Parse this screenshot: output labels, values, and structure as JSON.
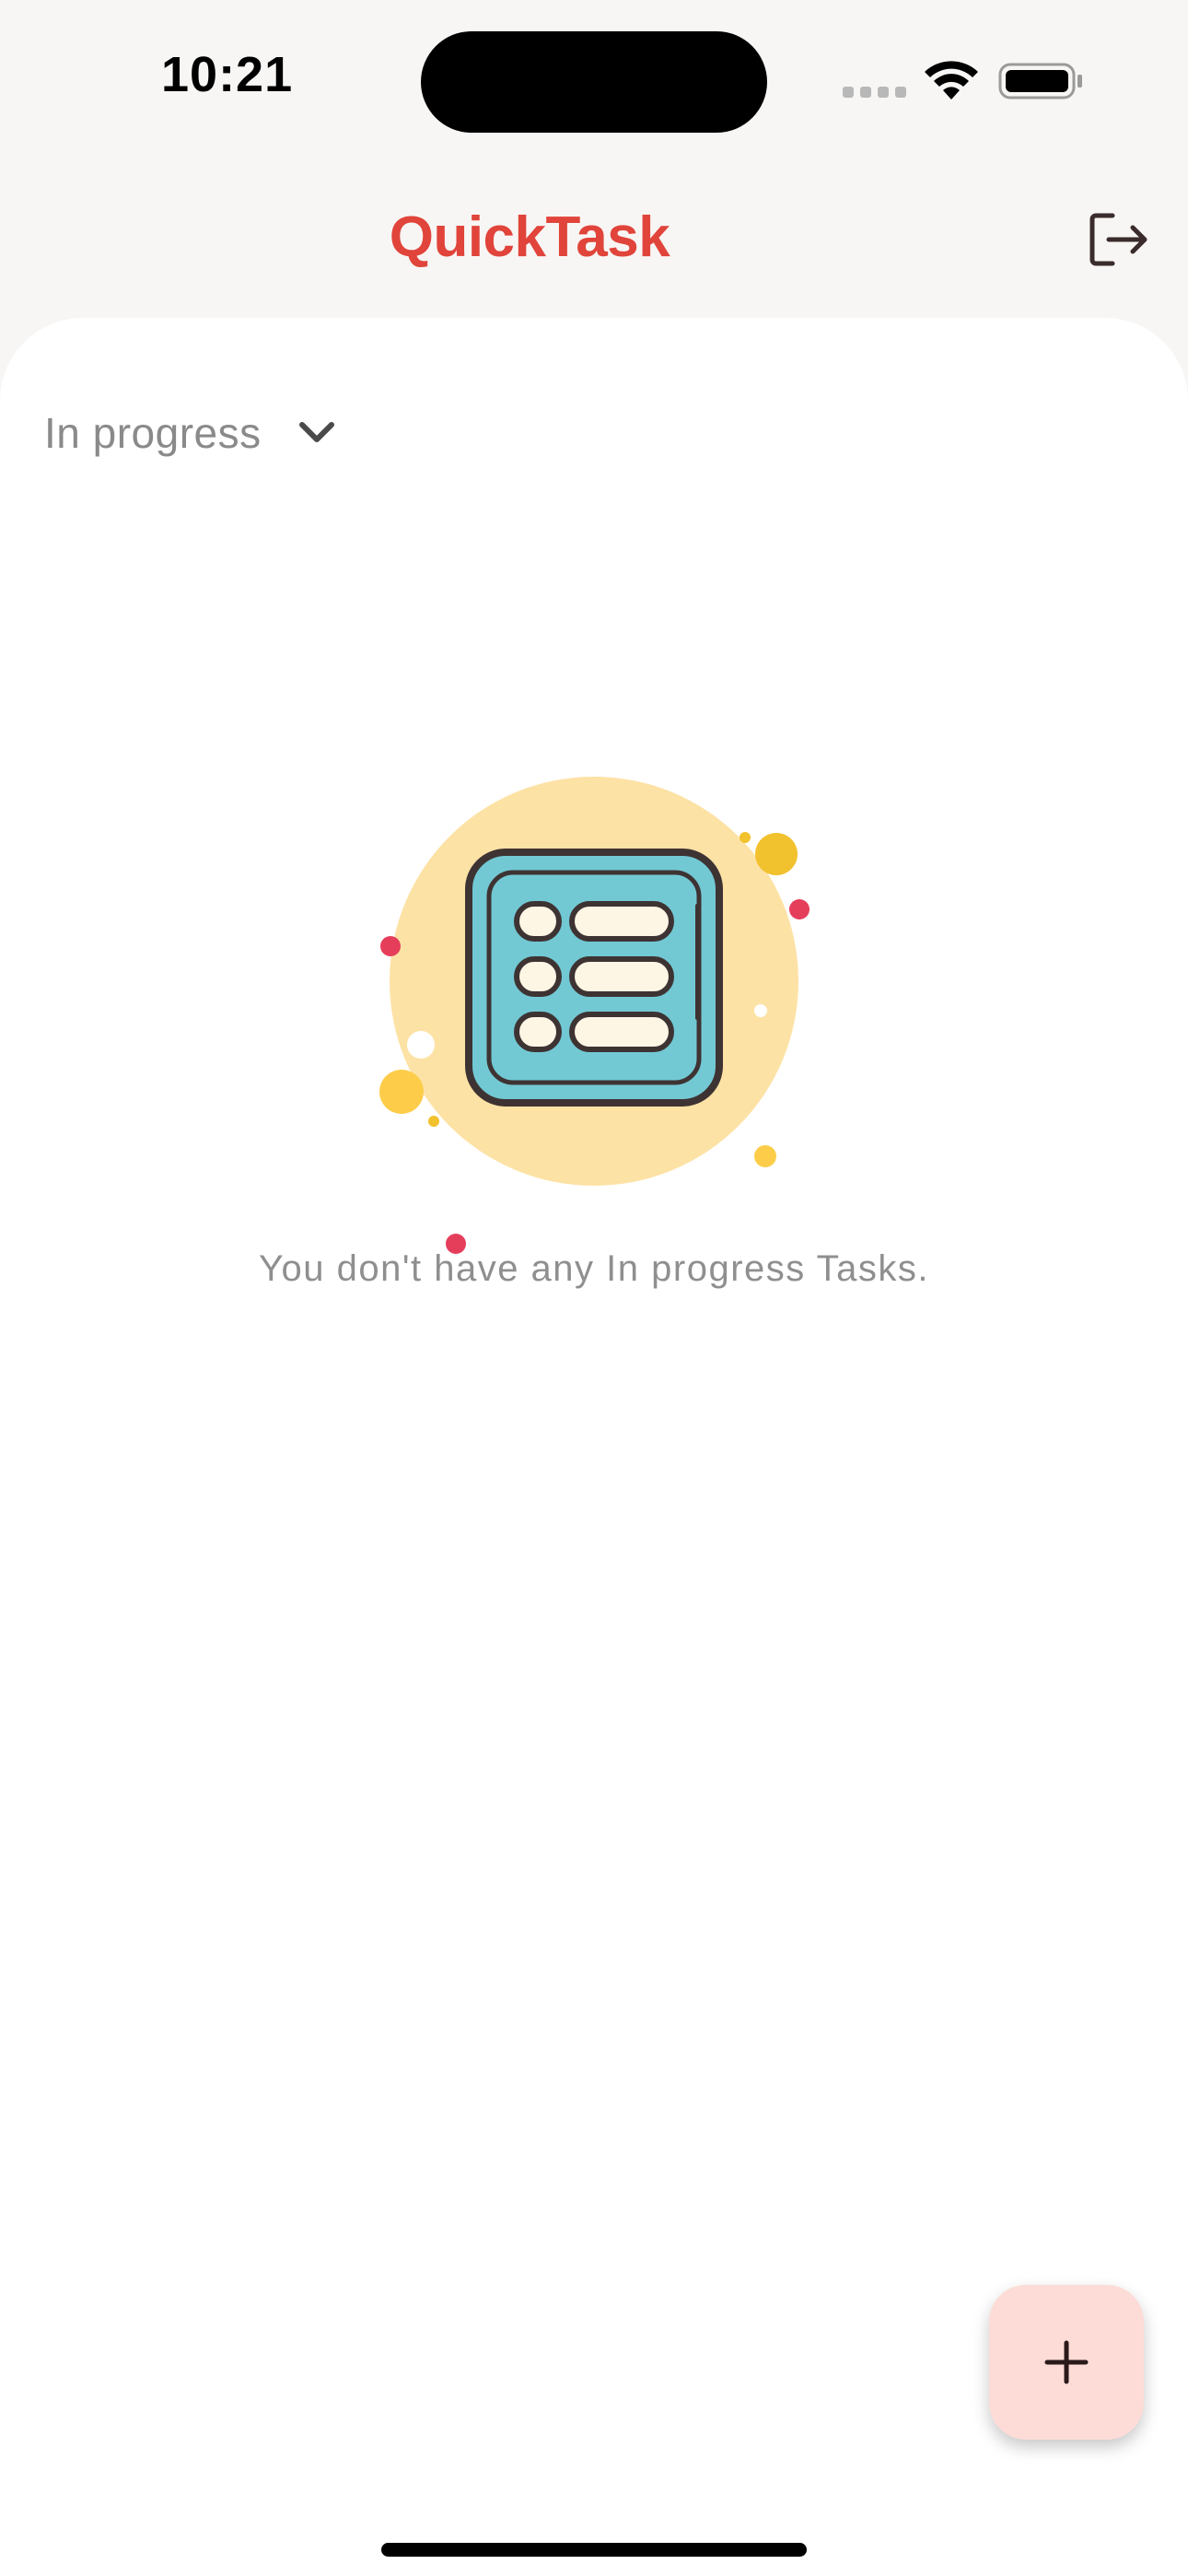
{
  "status_bar": {
    "time": "10:21"
  },
  "app_bar": {
    "title": "QuickTask",
    "logout_icon": "logout-icon",
    "title_color": "#e0443a"
  },
  "filter": {
    "selected": "In progress",
    "icon": "chevron-down-icon"
  },
  "empty_state": {
    "message": "You don't have any In progress Tasks.",
    "illustration": "task-list-illustration"
  },
  "fab": {
    "icon": "plus-icon",
    "background": "#fddcd7"
  },
  "colors": {
    "accent": "#e0443a",
    "sheet_background": "#ffffff",
    "app_background": "#f8f6f4"
  }
}
